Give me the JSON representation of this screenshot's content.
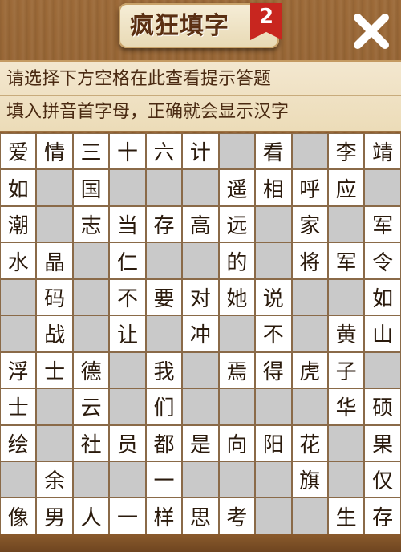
{
  "header": {
    "title": "疯狂填字",
    "level_badge": "2"
  },
  "icons": {
    "close": "close-icon"
  },
  "hints": {
    "line1": "请选择下方空格在此查看提示答题",
    "line2": "填入拼音首字母，正确就会显示汉字"
  },
  "grid": [
    [
      "爱",
      "情",
      "三",
      "十",
      "六",
      "计",
      "",
      "看",
      "",
      "李",
      "靖"
    ],
    [
      "如",
      "",
      "国",
      "",
      "",
      "",
      "遥",
      "相",
      "呼",
      "应",
      ""
    ],
    [
      "潮",
      "",
      "志",
      "当",
      "存",
      "高",
      "远",
      "",
      "家",
      "",
      "军"
    ],
    [
      "水",
      "晶",
      "",
      "仁",
      "",
      "",
      "的",
      "",
      "将",
      "军",
      "令"
    ],
    [
      "",
      "码",
      "",
      "不",
      "要",
      "对",
      "她",
      "说",
      "",
      "",
      "如"
    ],
    [
      "",
      "战",
      "",
      "让",
      "",
      "冲",
      "",
      "不",
      "",
      "黄",
      "山"
    ],
    [
      "浮",
      "士",
      "德",
      "",
      "我",
      "",
      "焉",
      "得",
      "虎",
      "子",
      ""
    ],
    [
      "士",
      "",
      "云",
      "",
      "们",
      "",
      "",
      "",
      "",
      "华",
      "硕"
    ],
    [
      "绘",
      "",
      "社",
      "员",
      "都",
      "是",
      "向",
      "阳",
      "花",
      "",
      "果"
    ],
    [
      "",
      "余",
      "",
      "",
      "一",
      "",
      "",
      "",
      "旗",
      "",
      "仅"
    ],
    [
      "像",
      "男",
      "人",
      "一",
      "样",
      "思",
      "考",
      "",
      "",
      "生",
      "存"
    ]
  ]
}
